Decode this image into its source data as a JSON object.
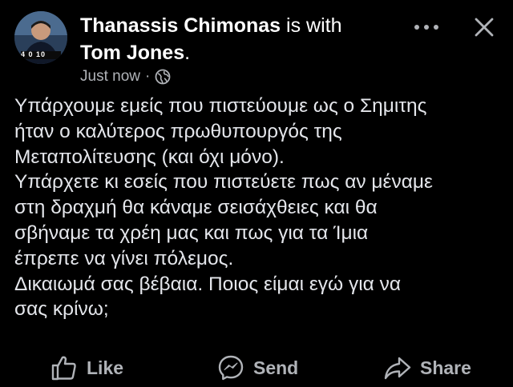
{
  "header": {
    "author_name": "Thanassis Chimonas",
    "with_text": "is with",
    "tagged_name": "Tom Jones",
    "tagged_suffix": ".",
    "timestamp": "Just now",
    "separator": "·",
    "audience_icon": "globe-icon",
    "more_icon": "more-dots-icon",
    "close_icon": "close-icon",
    "avatar_jersey_text": "4 0 10"
  },
  "post": {
    "lines": [
      "Υπάρχουμε εμείς που πιστεύουμε ως ο Σημιτης",
      "ήταν ο καλύτερος πρωθυπουργός της",
      "Μεταπολίτευσης (και όχι μόνο).",
      "Υπάρχετε κι εσείς που πιστεύετε πως αν μέναμε",
      "στη δραχμή θα κάναμε σεισάχθειες και θα",
      "σβήναμε τα χρέη μας και πως για τα Ίμια",
      "έπρεπε να γίνει πόλεμος.",
      "Δικαιωμά σας βέβαια. Ποιος είμαι εγώ για να",
      "σας κρίνω;"
    ]
  },
  "actions": {
    "like_label": "Like",
    "send_label": "Send",
    "share_label": "Share",
    "like_icon": "thumbs-up-icon",
    "send_icon": "messenger-icon",
    "share_icon": "share-arrow-icon"
  },
  "colors": {
    "background": "#000000",
    "text_primary": "#e4e6eb",
    "text_secondary": "#b0b3b8"
  }
}
